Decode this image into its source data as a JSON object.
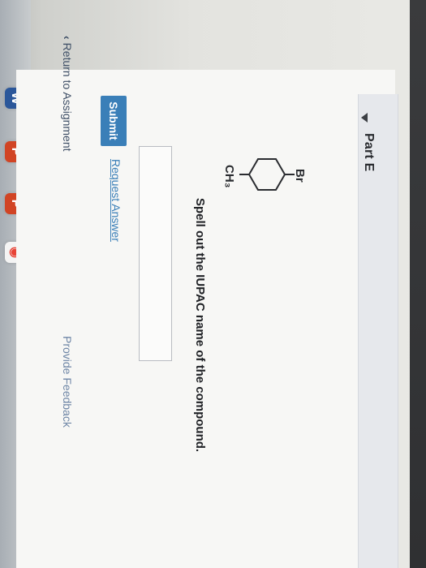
{
  "taskbar": {
    "icons": [
      {
        "name": "word-icon",
        "letter": "W",
        "bg": "#2b579a",
        "fg": "#ffffff"
      },
      {
        "name": "powerpoint-icon",
        "letter": "P",
        "bg": "#d14424",
        "fg": "#ffffff"
      },
      {
        "name": "powerpoint-icon-2",
        "letter": "P",
        "bg": "#d14424",
        "fg": "#ffffff"
      },
      {
        "name": "chrome-icon",
        "letter": "◉",
        "bg": "#f4f4f4",
        "fg": "#e84336"
      }
    ]
  },
  "part": {
    "title": "Part E"
  },
  "molecule": {
    "top_label": "Br",
    "bottom_label": "CH₃"
  },
  "question": {
    "prompt": "Spell out the IUPAC name of the compound."
  },
  "actions": {
    "submit_label": "Submit",
    "request_answer_label": "Request Answer"
  },
  "footer": {
    "return_label": "Return to Assignment",
    "feedback_label": "Provide Feedback"
  },
  "colors": {
    "accent": "#3a7fb8",
    "header_bg": "#e6e8ec",
    "panel_bg": "#f7f7f5"
  }
}
